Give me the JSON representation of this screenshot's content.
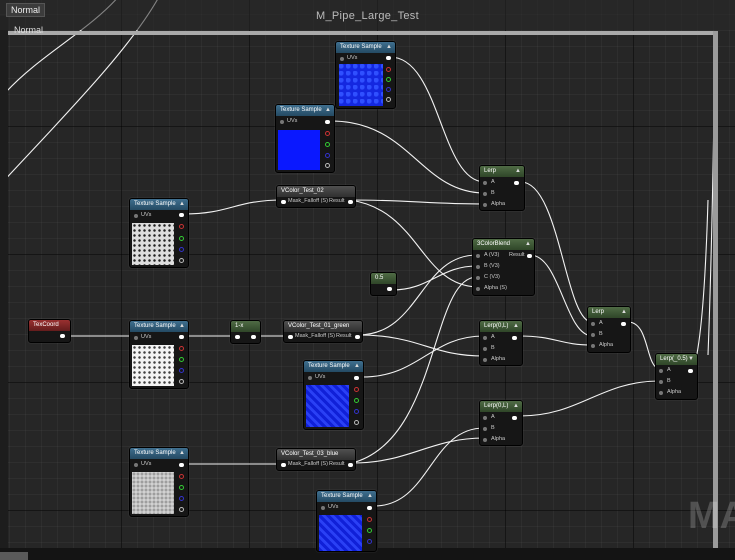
{
  "window": {
    "title": "M_Pipe_Large_Test",
    "mode_tag_top": "Normal",
    "mode_tag_second": "Normal",
    "watermark": "MA"
  },
  "texture_sample": {
    "title": "Texture Sample",
    "uv_label": "UVs"
  },
  "nodes": {
    "texcoord": {
      "title": "TexCoord"
    },
    "one_minus": {
      "title": "1-x"
    },
    "const_05": {
      "title": "0.5"
    },
    "vcolor_02": {
      "title": "VColor_Test_02",
      "in_label": "Mask_Falloff (S)",
      "out_label": "Result"
    },
    "vcolor_01": {
      "title": "VColor_Test_01_green",
      "in_label": "Mask_Falloff (S)",
      "out_label": "Result"
    },
    "vcolor_03": {
      "title": "VColor_Test_03_blue",
      "in_label": "Mask_Falloff (S)",
      "out_label": "Result"
    },
    "lerp_top": {
      "title": "Lerp",
      "a": "A",
      "b": "B",
      "alpha": "Alpha"
    },
    "color_blend": {
      "title": "3ColorBlend",
      "a": "A (V3)",
      "b": "B (V3)",
      "c": "C (V3)",
      "alpha": "Alpha (S)",
      "result": "Result"
    },
    "lerp_mid": {
      "title": "Lerp(0,L)",
      "a": "A",
      "b": "B",
      "alpha": "Alpha"
    },
    "lerp_low": {
      "title": "Lerp(0,L)",
      "a": "A",
      "b": "B",
      "alpha": "Alpha"
    },
    "lerp_right": {
      "title": "Lerp",
      "a": "A",
      "b": "B",
      "alpha": "Alpha"
    },
    "lerp_final": {
      "title": "Lerp(_0.5)",
      "a": "A",
      "b": "B",
      "alpha": "Alpha"
    }
  },
  "colors": {
    "graph_bg": "#262626",
    "texture_header": "#2f5a78",
    "math_header": "#3d5635",
    "param_header": "#7c2626",
    "wire": "#f2f2f2"
  }
}
